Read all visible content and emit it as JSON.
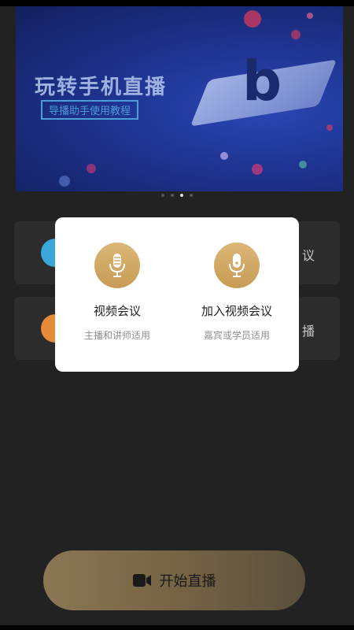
{
  "banner": {
    "title": "玩转手机直播",
    "subtitle": "导播助手使用教程",
    "carousel_count": 4,
    "carousel_active_index": 2
  },
  "background_cards": [
    {
      "side_label": "议",
      "icon_color": "#3aa7d8"
    },
    {
      "side_label": "播",
      "icon_color": "#e68a3c"
    }
  ],
  "dialog": {
    "options": [
      {
        "title": "视频会议",
        "subtitle": "主播和讲师适用",
        "icon": "microphone-icon"
      },
      {
        "title": "加入视频会议",
        "subtitle": "嘉宾或学员适用",
        "icon": "microphone-icon"
      }
    ]
  },
  "start_button": {
    "label": "开始直播",
    "icon": "video-camera-icon"
  },
  "colors": {
    "accent_gold": "#c9a15b",
    "background": "#222222",
    "dialog_bg": "#ffffff"
  }
}
